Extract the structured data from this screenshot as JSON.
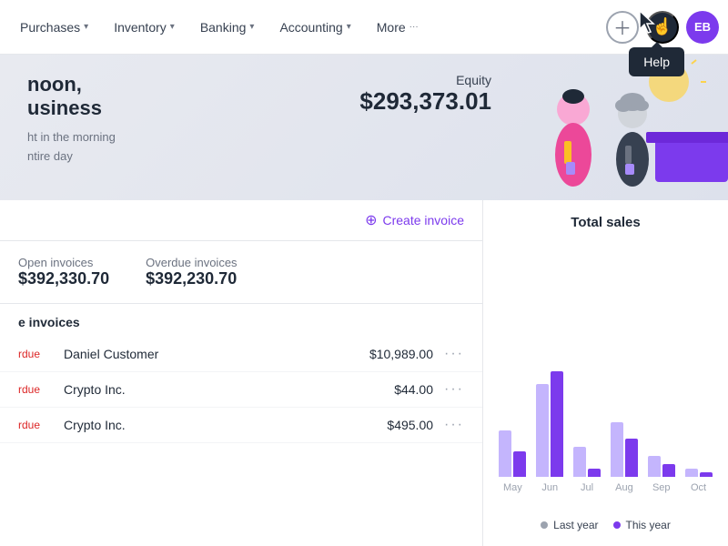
{
  "nav": {
    "items": [
      {
        "label": "Purchases",
        "id": "purchases"
      },
      {
        "label": "Inventory",
        "id": "inventory"
      },
      {
        "label": "Banking",
        "id": "banking"
      },
      {
        "label": "Accounting",
        "id": "accounting"
      },
      {
        "label": "More",
        "id": "more"
      }
    ],
    "add_label": "+",
    "help_label": "?",
    "avatar_label": "EB",
    "more_dots": "···"
  },
  "tooltip": {
    "label": "Help"
  },
  "hero": {
    "greeting_line1": "noon,",
    "greeting_line2": "usiness",
    "subtitle_line1": "ht in the morning",
    "subtitle_line2": "ntire day",
    "equity_label": "Equity",
    "equity_value": "$293,373.01"
  },
  "invoices": {
    "create_label": "Create invoice",
    "summary": [
      {
        "label": "Open invoices",
        "value": "$392,330.70"
      },
      {
        "label": "Overdue invoices",
        "value": "$392,230.70"
      }
    ],
    "section_title": "e invoices",
    "rows": [
      {
        "status": "rdue",
        "customer": "Daniel Customer",
        "amount": "$10,989.00"
      },
      {
        "status": "rdue",
        "customer": "Crypto Inc.",
        "amount": "$44.00"
      },
      {
        "status": "rdue",
        "customer": "Crypto Inc.",
        "amount": "$495.00"
      }
    ]
  },
  "chart": {
    "title": "Total sales",
    "bars": [
      {
        "label": "May",
        "last_year": 55,
        "this_year": 30
      },
      {
        "label": "Jun",
        "last_year": 110,
        "this_year": 125
      },
      {
        "label": "Jul",
        "last_year": 35,
        "this_year": 10
      },
      {
        "label": "Aug",
        "last_year": 65,
        "this_year": 45
      },
      {
        "label": "Sep",
        "last_year": 25,
        "this_year": 15
      },
      {
        "label": "Oct",
        "last_year": 10,
        "this_year": 5
      }
    ],
    "legend": [
      {
        "label": "Last year",
        "type": "last-year"
      },
      {
        "label": "This year",
        "type": "this-year"
      }
    ]
  }
}
